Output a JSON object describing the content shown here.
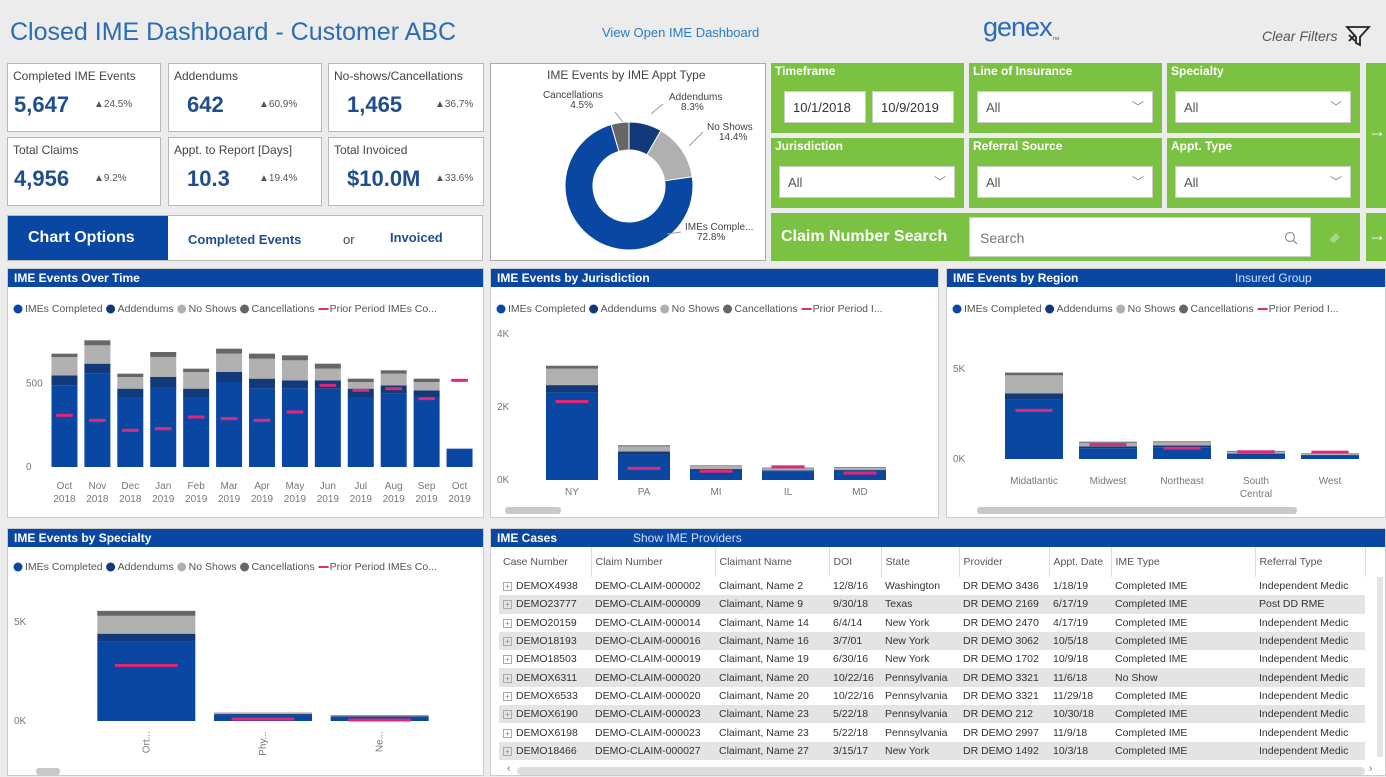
{
  "header": {
    "title": "Closed IME Dashboard - Customer ABC",
    "link": "View Open IME Dashboard",
    "logo": "genex",
    "clear_filters": "Clear Filters"
  },
  "kpis": [
    {
      "label": "Completed IME Events",
      "value": "5,647",
      "change": "▲24.5%"
    },
    {
      "label": "Addendums",
      "value": "642",
      "change": "▲60.9%"
    },
    {
      "label": "No-shows/Cancellations",
      "value": "1,465",
      "change": "▲36.7%"
    },
    {
      "label": "Total Claims",
      "value": "4,956",
      "change": "▲9.2%"
    },
    {
      "label": "Appt. to Report [Days]",
      "value": "10.3",
      "change": "▲19.4%"
    },
    {
      "label": "Total Invoiced",
      "value": "$10.0M",
      "change": "▲33.6%"
    }
  ],
  "chart_options": {
    "label": "Chart Options",
    "completed": "Completed Events",
    "or": "or",
    "invoiced": "Invoiced"
  },
  "filters": {
    "timeframe": {
      "label": "Timeframe",
      "start": "10/1/2018",
      "end": "10/9/2019"
    },
    "line_of_insurance": {
      "label": "Line of Insurance",
      "value": "All"
    },
    "specialty": {
      "label": "Specialty",
      "value": "All"
    },
    "jurisdiction": {
      "label": "Jurisdiction",
      "value": "All"
    },
    "referral_source": {
      "label": "Referral Source",
      "value": "All"
    },
    "appt_type": {
      "label": "Appt. Type",
      "value": "All"
    },
    "claim_search": {
      "label": "Claim Number Search",
      "placeholder": "Search"
    }
  },
  "colors": {
    "completed": "#0a47a3",
    "addendums": "#123a7a",
    "noshows": "#b0b0b0",
    "cancellations": "#666666",
    "prior": "#e0287a",
    "green": "#7bc142",
    "blue": "#0a47a3"
  },
  "legend": {
    "completed": "IMEs Completed",
    "addendums": "Addendums",
    "noshows": "No Shows",
    "cancellations": "Cancellations",
    "prior_long": "Prior Period IMEs Co...",
    "prior_short": "Prior Period I..."
  },
  "chart_data": [
    {
      "type": "pie",
      "title": "IME Events by IME Appt Type",
      "labels": [
        "Addendums",
        "No Shows",
        "IMEs Comple...",
        "Cancellations"
      ],
      "values": [
        8.3,
        14.4,
        72.8,
        4.5
      ],
      "value_labels": [
        "8.3%",
        "14.4%",
        "72.8%",
        "4.5%"
      ],
      "colors": [
        "#123a7a",
        "#b0b0b0",
        "#0a47a3",
        "#666666"
      ]
    },
    {
      "type": "bar",
      "title": "IME Events Over Time",
      "categories": [
        [
          "Oct",
          "2018"
        ],
        [
          "Nov",
          "2018"
        ],
        [
          "Dec",
          "2018"
        ],
        [
          "Jan",
          "2019"
        ],
        [
          "Feb",
          "2019"
        ],
        [
          "Mar",
          "2019"
        ],
        [
          "Apr",
          "2019"
        ],
        [
          "May",
          "2019"
        ],
        [
          "Jun",
          "2019"
        ],
        [
          "Jul",
          "2019"
        ],
        [
          "Aug",
          "2019"
        ],
        [
          "Sep",
          "2019"
        ],
        [
          "Oct",
          "2019"
        ]
      ],
      "yticks": [
        0,
        500
      ],
      "ylim": [
        0,
        780
      ],
      "series": [
        {
          "name": "IMEs Completed",
          "values": [
            490,
            560,
            420,
            480,
            420,
            510,
            470,
            470,
            470,
            420,
            440,
            420,
            110
          ]
        },
        {
          "name": "Addendums",
          "values": [
            60,
            60,
            50,
            60,
            50,
            60,
            60,
            50,
            50,
            50,
            50,
            40,
            0
          ]
        },
        {
          "name": "No Shows",
          "values": [
            110,
            110,
            70,
            120,
            100,
            110,
            120,
            120,
            70,
            40,
            70,
            50,
            0
          ]
        },
        {
          "name": "Cancellations",
          "values": [
            20,
            30,
            20,
            30,
            20,
            30,
            30,
            30,
            30,
            20,
            20,
            20,
            0
          ]
        },
        {
          "name": "Prior Period IMEs Co...",
          "values": [
            310,
            280,
            220,
            230,
            300,
            290,
            280,
            330,
            490,
            460,
            470,
            410,
            520
          ]
        }
      ]
    },
    {
      "type": "bar",
      "title": "IME Events by Jurisdiction",
      "categories": [
        "NY",
        "PA",
        "MI",
        "IL",
        "MD"
      ],
      "yticks": [
        "0K",
        "2K",
        "4K"
      ],
      "ylim": [
        0,
        4000
      ],
      "series": [
        {
          "name": "IMEs Completed",
          "values": [
            2400,
            700,
            260,
            230,
            250
          ]
        },
        {
          "name": "Addendums",
          "values": [
            200,
            80,
            40,
            30,
            30
          ]
        },
        {
          "name": "No Shows",
          "values": [
            450,
            140,
            80,
            60,
            50
          ]
        },
        {
          "name": "Cancellations",
          "values": [
            80,
            30,
            20,
            20,
            20
          ]
        },
        {
          "name": "Prior Period I...",
          "values": [
            2150,
            320,
            240,
            360,
            190
          ]
        }
      ]
    },
    {
      "type": "bar",
      "title": "IME Events by Region",
      "extra_label": "Insured Group",
      "categories": [
        [
          "Midatlantic"
        ],
        [
          "Midwest"
        ],
        [
          "Northeast"
        ],
        [
          "South",
          "Central"
        ],
        [
          "West"
        ]
      ],
      "yticks": [
        "0K",
        "5K"
      ],
      "ylim": [
        0,
        6000
      ],
      "series": [
        {
          "name": "IMEs Completed",
          "values": [
            3300,
            600,
            650,
            250,
            200
          ]
        },
        {
          "name": "Addendums",
          "values": [
            350,
            100,
            100,
            50,
            30
          ]
        },
        {
          "name": "No Shows",
          "values": [
            1000,
            200,
            180,
            110,
            80
          ]
        },
        {
          "name": "Cancellations",
          "values": [
            150,
            60,
            50,
            40,
            20
          ]
        },
        {
          "name": "Prior Period I...",
          "values": [
            2700,
            800,
            600,
            400,
            380
          ]
        }
      ]
    },
    {
      "type": "bar",
      "title": "IME Events by Specialty",
      "categories": [
        "Ort...",
        "Phy...",
        "Ne..."
      ],
      "yticks": [
        "0K",
        "5K"
      ],
      "ylim": [
        0,
        6500
      ],
      "series": [
        {
          "name": "IMEs Completed",
          "values": [
            4000,
            300,
            200
          ]
        },
        {
          "name": "Addendums",
          "values": [
            400,
            50,
            40
          ]
        },
        {
          "name": "No Shows",
          "values": [
            900,
            50,
            40
          ]
        },
        {
          "name": "Cancellations",
          "values": [
            250,
            20,
            20
          ]
        },
        {
          "name": "Prior Period IMEs Co...",
          "values": [
            2800,
            100,
            50
          ]
        }
      ]
    }
  ],
  "cases": {
    "title": "IME Cases",
    "link": "Show IME Providers",
    "columns": [
      "Case Number",
      "Claim Number",
      "Claimant Name",
      "DOI",
      "State",
      "Provider",
      "Appt. Date",
      "IME Type",
      "Referral Type"
    ],
    "rows": [
      [
        "DEMOX4938",
        "DEMO-CLAIM-000002",
        "Claimant, Name 2",
        "12/8/16",
        "Washington",
        "DR DEMO 3436",
        "1/18/19",
        "Completed IME",
        "Independent Medic"
      ],
      [
        "DEMO23777",
        "DEMO-CLAIM-000009",
        "Claimant, Name 9",
        "9/30/18",
        "Texas",
        "DR DEMO 2169",
        "6/17/19",
        "Completed IME",
        "Post DD RME"
      ],
      [
        "DEMO20159",
        "DEMO-CLAIM-000014",
        "Claimant, Name 14",
        "6/4/14",
        "New York",
        "DR DEMO 2470",
        "4/17/19",
        "Completed IME",
        "Independent Medic"
      ],
      [
        "DEMO18193",
        "DEMO-CLAIM-000016",
        "Claimant, Name 16",
        "3/7/01",
        "New York",
        "DR DEMO 3062",
        "10/5/18",
        "Completed IME",
        "Independent Medic"
      ],
      [
        "DEMO18503",
        "DEMO-CLAIM-000019",
        "Claimant, Name 19",
        "6/30/16",
        "New York",
        "DR DEMO 1702",
        "10/9/18",
        "Completed IME",
        "Independent Medic"
      ],
      [
        "DEMOX6311",
        "DEMO-CLAIM-000020",
        "Claimant, Name 20",
        "10/22/16",
        "Pennsylvania",
        "DR DEMO 3321",
        "11/6/18",
        "No Show",
        "Independent Medic"
      ],
      [
        "DEMOX6533",
        "DEMO-CLAIM-000020",
        "Claimant, Name 20",
        "10/22/16",
        "Pennsylvania",
        "DR DEMO 3321",
        "11/29/18",
        "Completed IME",
        "Independent Medic"
      ],
      [
        "DEMOX6190",
        "DEMO-CLAIM-000023",
        "Claimant, Name 23",
        "5/22/18",
        "Pennsylvania",
        "DR DEMO 212",
        "10/30/18",
        "Completed IME",
        "Independent Medic"
      ],
      [
        "DEMOX6198",
        "DEMO-CLAIM-000023",
        "Claimant, Name 23",
        "5/22/18",
        "Pennsylvania",
        "DR DEMO 2997",
        "11/9/18",
        "Completed IME",
        "Independent Medic"
      ],
      [
        "DEMO18466",
        "DEMO-CLAIM-000027",
        "Claimant, Name 27",
        "3/15/17",
        "New York",
        "DR DEMO 1492",
        "10/3/18",
        "Completed IME",
        "Independent Medic"
      ]
    ]
  }
}
